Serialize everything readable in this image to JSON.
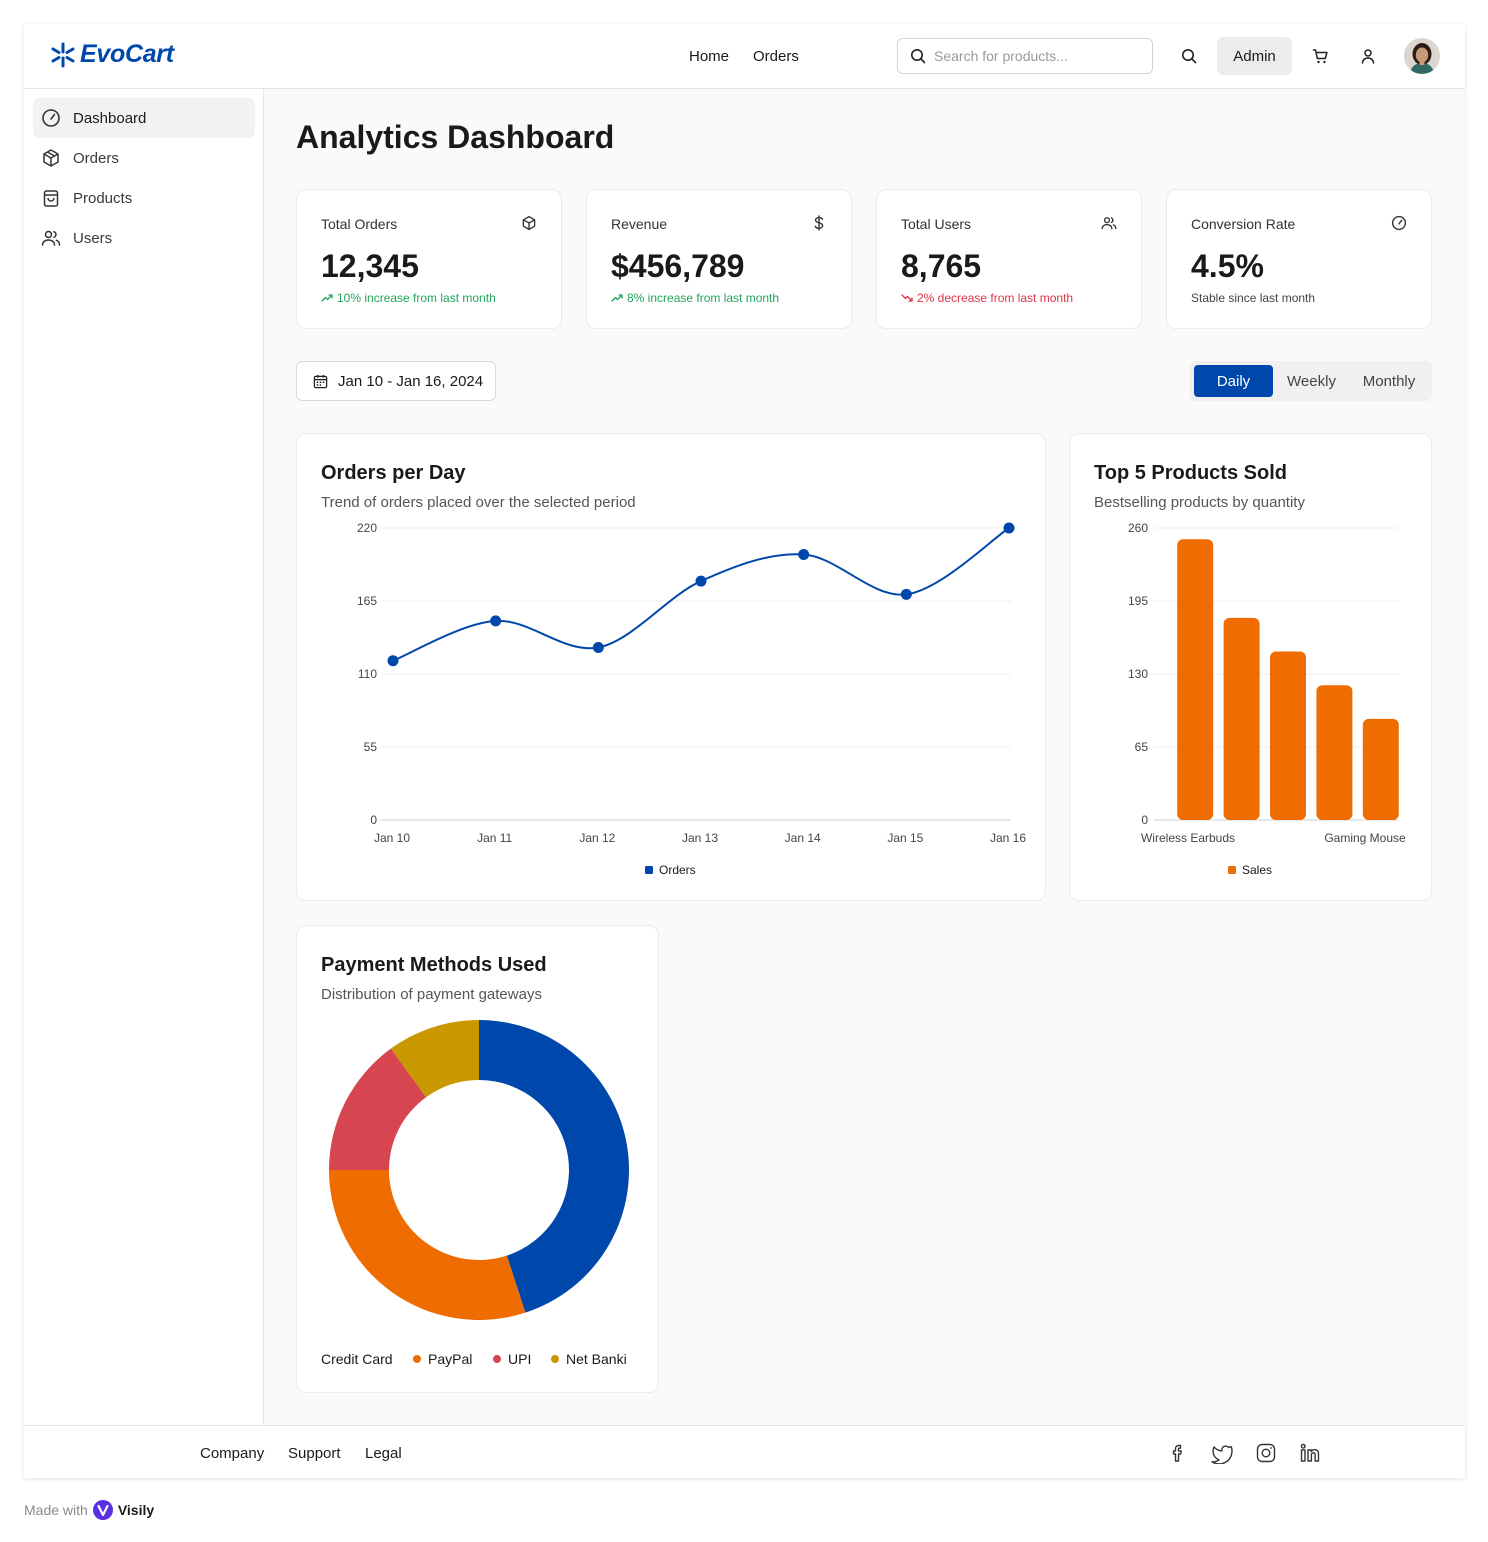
{
  "app": {
    "name": "EvoCart",
    "accent": "#0047ab"
  },
  "header": {
    "nav": [
      "Home",
      "Orders"
    ],
    "search_placeholder": "Search for products...",
    "admin_label": "Admin"
  },
  "sidebar": {
    "items": [
      {
        "label": "Dashboard",
        "icon": "gauge-icon",
        "active": true
      },
      {
        "label": "Orders",
        "icon": "package-icon",
        "active": false
      },
      {
        "label": "Products",
        "icon": "shopping-bag-icon",
        "active": false
      },
      {
        "label": "Users",
        "icon": "users-icon",
        "active": false
      }
    ]
  },
  "page": {
    "title": "Analytics Dashboard"
  },
  "stats": [
    {
      "label": "Total Orders",
      "value": "12,345",
      "note": "10% increase from last month",
      "trend": "up",
      "icon": "package-icon",
      "color": "#22a55b"
    },
    {
      "label": "Revenue",
      "value": "$456,789",
      "note": "8% increase from last month",
      "trend": "up",
      "icon": "dollar-icon",
      "color": "#22a55b"
    },
    {
      "label": "Total Users",
      "value": "8,765",
      "note": "2% decrease from last month",
      "trend": "down",
      "icon": "users-icon",
      "color": "#dc3545"
    },
    {
      "label": "Conversion Rate",
      "value": "4.5%",
      "note": "Stable since last month",
      "trend": "flat",
      "icon": "gauge-icon",
      "color": "#444444"
    }
  ],
  "filters": {
    "date_range": "Jan 10 - Jan 16, 2024",
    "periods": [
      "Daily",
      "Weekly",
      "Monthly"
    ],
    "active_period": "Daily"
  },
  "orders_chart": {
    "title": "Orders per Day",
    "subtitle": "Trend of orders placed over the selected period"
  },
  "products_chart": {
    "title": "Top 5 Products Sold",
    "subtitle": "Bestselling products by quantity"
  },
  "payments_chart": {
    "title": "Payment Methods Used",
    "subtitle": "Distribution of payment gateways"
  },
  "chart_data": [
    {
      "type": "line",
      "categories": [
        "Jan 10",
        "Jan 11",
        "Jan 12",
        "Jan 13",
        "Jan 14",
        "Jan 15",
        "Jan 16"
      ],
      "series": [
        {
          "name": "Orders",
          "values": [
            120,
            150,
            130,
            180,
            200,
            170,
            220
          ],
          "color": "#0047ab"
        }
      ],
      "yticks": [
        0,
        55,
        110,
        165,
        220
      ],
      "ylim": [
        0,
        220
      ],
      "grid": true,
      "legend": "bottom"
    },
    {
      "type": "bar",
      "categories": [
        "Wireless Earbuds",
        "",
        "",
        "",
        "Gaming Mouse"
      ],
      "series": [
        {
          "name": "Sales",
          "values": [
            250,
            180,
            150,
            120,
            90
          ],
          "color": "#ef6c00"
        }
      ],
      "yticks": [
        0,
        65,
        130,
        195,
        260
      ],
      "ylim": [
        0,
        260
      ],
      "grid": true,
      "legend": "bottom"
    },
    {
      "type": "pie",
      "donut": true,
      "categories": [
        "Credit Card",
        "PayPal",
        "UPI",
        "Net Banki"
      ],
      "values": [
        45,
        30,
        15,
        10
      ],
      "colors": [
        "#0047ab",
        "#ef6c00",
        "#d64550",
        "#c99700"
      ],
      "legend": "bottom"
    }
  ],
  "footer": {
    "links": [
      "Company",
      "Support",
      "Legal"
    ],
    "social": [
      "facebook-icon",
      "twitter-icon",
      "instagram-icon",
      "linkedin-icon"
    ]
  },
  "made_with": {
    "prefix": "Made with",
    "brand": "Visily"
  }
}
